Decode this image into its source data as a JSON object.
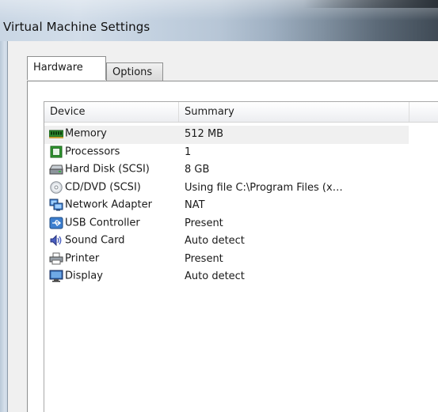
{
  "window": {
    "title": "Virtual Machine Settings"
  },
  "tabs": [
    {
      "label": "Hardware",
      "active": true
    },
    {
      "label": "Options",
      "active": false
    }
  ],
  "list": {
    "columns": [
      "Device",
      "Summary"
    ],
    "rows": [
      {
        "device": "Memory",
        "summary": "512 MB",
        "icon": "memory-icon",
        "selected": true
      },
      {
        "device": "Processors",
        "summary": "1",
        "icon": "processor-icon"
      },
      {
        "device": "Hard Disk (SCSI)",
        "summary": "8 GB",
        "icon": "hard-disk-icon"
      },
      {
        "device": "CD/DVD (SCSI)",
        "summary": "Using file C:\\Program Files (x…",
        "icon": "cd-dvd-icon"
      },
      {
        "device": "Network Adapter",
        "summary": "NAT",
        "icon": "network-adapter-icon"
      },
      {
        "device": "USB Controller",
        "summary": "Present",
        "icon": "usb-icon"
      },
      {
        "device": "Sound Card",
        "summary": "Auto detect",
        "icon": "sound-card-icon"
      },
      {
        "device": "Printer",
        "summary": "Present",
        "icon": "printer-icon"
      },
      {
        "device": "Display",
        "summary": "Auto detect",
        "icon": "display-icon"
      }
    ]
  },
  "colors": {
    "selected_row": "#f0f0f0",
    "memory_green": "#2e8b2e"
  }
}
